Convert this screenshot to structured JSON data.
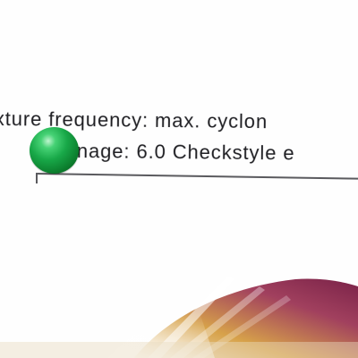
{
  "caption": {
    "line1": "xture frequency: max. cyclon",
    "line2": "nage: 6.0 Checkstyle e"
  },
  "colors": {
    "text": "#1e1e22",
    "sphere": "#18a848",
    "ruler": "#5a5a5e",
    "fan_magenta": "#8a2a55",
    "fan_gold": "#d7a24a"
  },
  "icons": {
    "marker": "green-sphere-icon"
  }
}
